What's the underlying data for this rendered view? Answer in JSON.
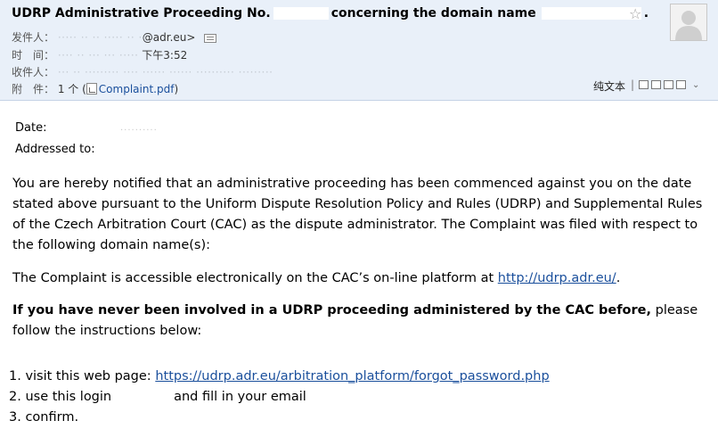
{
  "email": {
    "subject_part1": "UDRP Administrative Proceeding No.",
    "subject_part2": "concerning the domain name",
    "subject_end": ".",
    "from_label": "发件人：",
    "from_blurred": "·····  ·· ·· ·····   ·· ·",
    "from_domain": "@adr.eu>",
    "time_label": "时　间：",
    "time_blurred": "···· ·· ··· ··· ·····",
    "time_value": "下午3:52",
    "to_label": "收件人：",
    "to_blurred": "···  ··  ·········  ····  ······  ······  ··········  ·········",
    "attach_label": "附　件：",
    "attach_count": "1 个 (",
    "attach_name": "Complaint.pdf",
    "attach_close": ")",
    "plain_text": "纯文本",
    "separator": "|"
  },
  "body": {
    "date_label": "Date:",
    "addressed_label": "Addressed to:",
    "redacted_marks": "··········",
    "para1": "You are hereby notified that an administrative proceeding has been commenced against you on the date stated above pursuant to the Uniform Dispute Resolution Policy and Rules (UDRP) and Supplemental Rules of the Czech Arbitration Court (CAC) as the dispute administrator. The Complaint was filed with respect to the following domain name(s):",
    "para2_text": "The Complaint is accessible electronically on the CAC’s on-line platform at ",
    "para2_link": "http://udrp.adr.eu/",
    "para2_end": ".",
    "para3_bold": "If you have never been involved in a UDRP proceeding administered by the CAC before,",
    "para3_rest": " please follow the instructions below:",
    "step1_text": "1. visit this web page: ",
    "step1_link": "https://udrp.adr.eu/arbitration_platform/forgot_password.php",
    "step2_text": "2. use this login",
    "step2_rest": "and fill in your email",
    "step3_text": "3. confirm."
  },
  "icons": {
    "star": "star-icon",
    "avatar": "avatar-placeholder-icon",
    "vcard": "contact-card-icon",
    "pdf": "pdf-file-icon",
    "tools": [
      "new-window-icon",
      "copy-icon",
      "print-icon",
      "more-icon"
    ]
  },
  "colors": {
    "header_bg": "#e9f0f9",
    "link": "#1a4f9c"
  }
}
